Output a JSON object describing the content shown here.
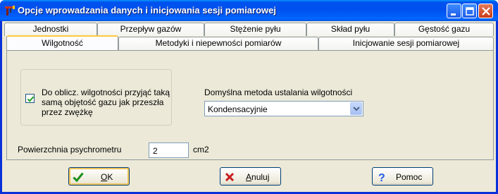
{
  "window": {
    "title": "Opcje wprowadzania danych i inicjowania sesji pomiarowej",
    "controls": {
      "minimize": "_",
      "maximize": "□",
      "close": "✕"
    }
  },
  "tabs": {
    "row1": [
      "Jednostki",
      "Przepływ gazów",
      "Stężenie pyłu",
      "Skład pyłu",
      "Gęstość gazu"
    ],
    "row2": [
      "Wilgotność",
      "Metodyki i niepewności pomiarów",
      "Inicjowanie sesji pomiarowej"
    ],
    "active": "Wilgotność"
  },
  "panel": {
    "checkbox": {
      "checked": true,
      "label": "Do oblicz. wilgotności przyjąć taką samą objętość gazu jak przeszła przez zwężkę"
    },
    "method": {
      "label": "Domyślna metoda ustalania wilgotności",
      "selected": "Kondensacyjnie"
    },
    "area": {
      "label": "Powierzchnia psychrometru",
      "value": "2",
      "unit": "cm2"
    }
  },
  "buttons": {
    "ok": {
      "label_underlined": "O",
      "label_rest": "K",
      "icon": "checkmark-icon"
    },
    "cancel": {
      "label_underlined": "A",
      "label_rest": "nuluj",
      "icon": "x-icon"
    },
    "help": {
      "label_underlined": "",
      "label_rest": "Pomoc",
      "icon": "question-icon"
    }
  },
  "colors": {
    "accent": "#0053ee",
    "tab_highlight": "#ffc83c",
    "ok_green": "#1a8f1a",
    "cancel_red": "#c81e1e",
    "help_blue": "#1f5ce8"
  }
}
